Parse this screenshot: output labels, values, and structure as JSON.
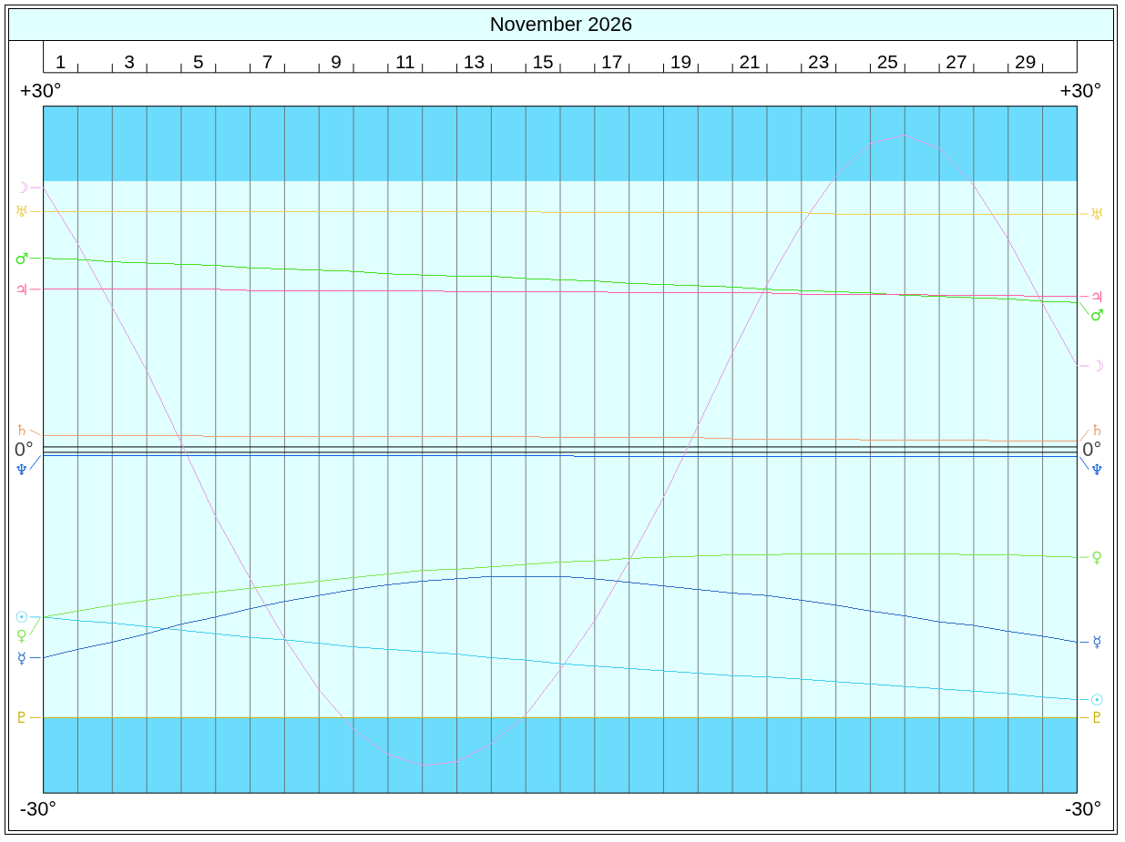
{
  "chart_data": {
    "type": "line",
    "title": "November 2026",
    "x": [
      1,
      2,
      3,
      4,
      5,
      6,
      7,
      8,
      9,
      10,
      11,
      12,
      13,
      14,
      15,
      16,
      17,
      18,
      19,
      20,
      21,
      22,
      23,
      24,
      25,
      26,
      27,
      28,
      29,
      30,
      31
    ],
    "xlim": [
      1,
      31
    ],
    "ylim": [
      -30,
      30
    ],
    "xticks": [
      {
        "value": 1.5,
        "label": "1"
      },
      {
        "value": 3.5,
        "label": "3"
      },
      {
        "value": 5.5,
        "label": "5"
      },
      {
        "value": 7.5,
        "label": "7"
      },
      {
        "value": 9.5,
        "label": "9"
      },
      {
        "value": 11.5,
        "label": "11"
      },
      {
        "value": 13.5,
        "label": "13"
      },
      {
        "value": 15.5,
        "label": "15"
      },
      {
        "value": 17.5,
        "label": "17"
      },
      {
        "value": 19.5,
        "label": "19"
      },
      {
        "value": 21.5,
        "label": "21"
      },
      {
        "value": 23.5,
        "label": "23"
      },
      {
        "value": 25.5,
        "label": "25"
      },
      {
        "value": 27.5,
        "label": "27"
      },
      {
        "value": 29.5,
        "label": "29"
      }
    ],
    "yticks": [
      {
        "value": 30,
        "label": "+30°"
      },
      {
        "value": 0,
        "label": "0°"
      },
      {
        "value": -30,
        "label": "-30°"
      }
    ],
    "bands": [
      {
        "axis": "y",
        "from": 22.45,
        "to": 28.7
      },
      {
        "axis": "y",
        "from": -28.7,
        "to": -22.45
      }
    ],
    "legend": "left",
    "series": [
      {
        "name": "☽",
        "color": "#e8a0e8",
        "values": [
          21.9,
          17.2,
          11.9,
          6.6,
          0.6,
          -5.6,
          -10.8,
          -15.8,
          -20.1,
          -23.4,
          -25.5,
          -26.4,
          -26.1,
          -24.6,
          -22.2,
          -18.4,
          -14.3,
          -9.3,
          -4.0,
          2.0,
          8.1,
          13.8,
          18.8,
          22.9,
          25.6,
          26.3,
          25.2,
          22.1,
          17.6,
          12.2,
          7.0
        ]
      },
      {
        "name": "♅",
        "color": "#f0d050",
        "values": [
          19.9,
          19.9,
          19.9,
          19.9,
          19.9,
          19.9,
          19.9,
          19.9,
          19.9,
          19.9,
          19.9,
          19.9,
          19.9,
          19.9,
          19.9,
          19.8,
          19.8,
          19.8,
          19.8,
          19.8,
          19.8,
          19.8,
          19.8,
          19.7,
          19.7,
          19.7,
          19.7,
          19.7,
          19.7,
          19.7,
          19.7
        ]
      },
      {
        "name": "♂",
        "color": "#40e020",
        "values": [
          16.0,
          15.9,
          15.7,
          15.6,
          15.5,
          15.4,
          15.2,
          15.1,
          15.0,
          14.9,
          14.7,
          14.6,
          14.5,
          14.5,
          14.3,
          14.2,
          14.1,
          13.9,
          13.8,
          13.7,
          13.6,
          13.4,
          13.3,
          13.2,
          13.1,
          12.9,
          12.8,
          12.7,
          12.6,
          12.4,
          12.3
        ]
      },
      {
        "name": "♃",
        "color": "#ff5fa0",
        "values": [
          13.4,
          13.4,
          13.4,
          13.4,
          13.4,
          13.4,
          13.3,
          13.3,
          13.3,
          13.3,
          13.3,
          13.3,
          13.2,
          13.2,
          13.2,
          13.2,
          13.2,
          13.1,
          13.1,
          13.1,
          13.1,
          13.1,
          13.0,
          13.0,
          13.0,
          13.0,
          12.9,
          12.9,
          12.9,
          12.8,
          12.8
        ]
      },
      {
        "name": "♄",
        "color": "#f0a070",
        "values": [
          1.2,
          1.2,
          1.2,
          1.2,
          1.2,
          1.1,
          1.1,
          1.1,
          1.1,
          1.1,
          1.1,
          1.1,
          1.1,
          1.1,
          1.1,
          1.0,
          1.0,
          1.0,
          1.0,
          1.0,
          0.9,
          0.9,
          0.9,
          0.9,
          0.8,
          0.8,
          0.8,
          0.8,
          0.7,
          0.7,
          0.7
        ]
      },
      {
        "name": "♆",
        "color": "#1060e0",
        "values": [
          -0.5,
          -0.5,
          -0.5,
          -0.5,
          -0.5,
          -0.5,
          -0.5,
          -0.5,
          -0.5,
          -0.5,
          -0.5,
          -0.5,
          -0.5,
          -0.5,
          -0.5,
          -0.5,
          -0.6,
          -0.6,
          -0.6,
          -0.6,
          -0.6,
          -0.6,
          -0.6,
          -0.6,
          -0.6,
          -0.6,
          -0.6,
          -0.6,
          -0.6,
          -0.6,
          -0.6
        ]
      },
      {
        "name": "☉",
        "color": "#40d0f0",
        "values": [
          -14.0,
          -14.3,
          -14.5,
          -14.8,
          -15.1,
          -15.4,
          -15.7,
          -15.9,
          -16.2,
          -16.5,
          -16.7,
          -16.9,
          -17.1,
          -17.4,
          -17.6,
          -17.9,
          -18.1,
          -18.3,
          -18.5,
          -18.7,
          -18.9,
          -19.0,
          -19.2,
          -19.4,
          -19.6,
          -19.8,
          -20.0,
          -20.2,
          -20.4,
          -20.7,
          -20.9
        ]
      },
      {
        "name": "♀",
        "color": "#80e850",
        "values": [
          -14.0,
          -13.5,
          -13.0,
          -12.6,
          -12.2,
          -11.9,
          -11.6,
          -11.3,
          -11.0,
          -10.7,
          -10.4,
          -10.1,
          -10.0,
          -9.8,
          -9.6,
          -9.4,
          -9.3,
          -9.1,
          -9.0,
          -8.9,
          -8.8,
          -8.8,
          -8.7,
          -8.7,
          -8.7,
          -8.7,
          -8.7,
          -8.8,
          -8.8,
          -8.9,
          -9.0
        ]
      },
      {
        "name": "☿",
        "color": "#3070c8",
        "values": [
          -17.4,
          -16.7,
          -16.1,
          -15.4,
          -14.6,
          -14.0,
          -13.3,
          -12.7,
          -12.2,
          -11.7,
          -11.3,
          -11.0,
          -10.8,
          -10.6,
          -10.6,
          -10.6,
          -10.8,
          -11.1,
          -11.4,
          -11.7,
          -12.0,
          -12.2,
          -12.6,
          -13.0,
          -13.5,
          -13.9,
          -14.4,
          -14.7,
          -15.2,
          -15.6,
          -16.1
        ]
      },
      {
        "name": "♇",
        "color": "#c8b400",
        "values": [
          -22.4,
          -22.4,
          -22.4,
          -22.4,
          -22.4,
          -22.4,
          -22.4,
          -22.4,
          -22.4,
          -22.4,
          -22.4,
          -22.4,
          -22.4,
          -22.4,
          -22.4,
          -22.4,
          -22.4,
          -22.4,
          -22.4,
          -22.4,
          -22.4,
          -22.4,
          -22.4,
          -22.4,
          -22.4,
          -22.4,
          -22.4,
          -22.4,
          -22.4,
          -22.4,
          -22.4
        ]
      }
    ],
    "annotations": [
      "☽",
      "♅",
      "♂",
      "♃",
      "♄",
      "♆",
      "☉",
      "♀",
      "☿",
      "♇"
    ]
  },
  "right_axis_labels": [
    "+30°",
    "0°",
    "-30°"
  ]
}
